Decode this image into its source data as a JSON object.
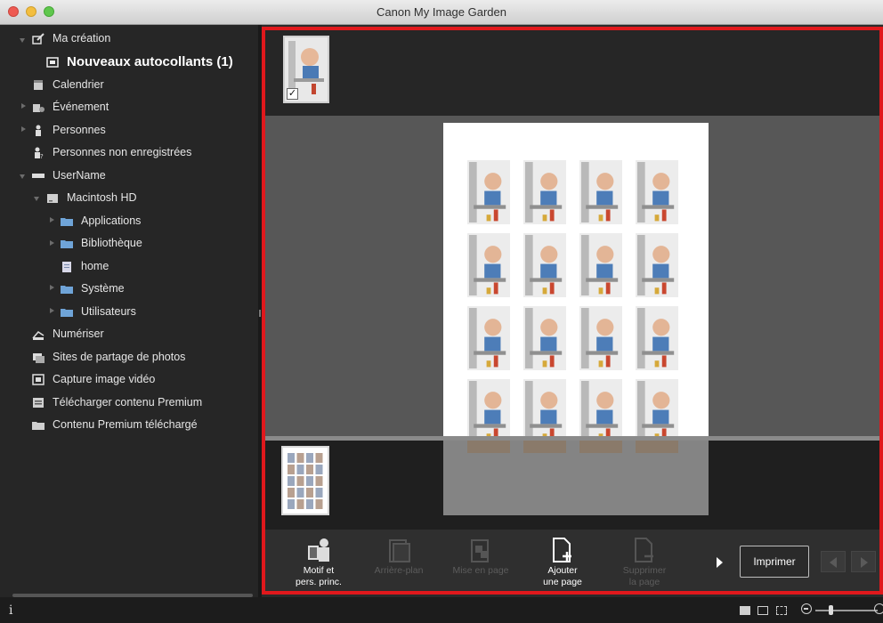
{
  "window": {
    "title": "Canon My Image Garden"
  },
  "sidebar": {
    "items": [
      {
        "label": "Ma création",
        "icon": "my-art-icon"
      },
      {
        "label": "Nouveaux autocollants (1)",
        "icon": "stickers-icon"
      },
      {
        "label": "Calendrier",
        "icon": "calendar-icon"
      },
      {
        "label": "Événement",
        "icon": "event-icon"
      },
      {
        "label": "Personnes",
        "icon": "people-icon"
      },
      {
        "label": "Personnes non enregistrées",
        "icon": "unregistered-people-icon"
      },
      {
        "label": "UserName",
        "icon": "drive-icon"
      },
      {
        "label": "Macintosh HD",
        "icon": "hard-disk-icon"
      },
      {
        "label": "Applications",
        "icon": "folder-icon"
      },
      {
        "label": "Bibliothèque",
        "icon": "folder-icon"
      },
      {
        "label": "home",
        "icon": "home-icon"
      },
      {
        "label": "Système",
        "icon": "folder-icon"
      },
      {
        "label": "Utilisateurs",
        "icon": "folder-icon"
      },
      {
        "label": "Numériser",
        "icon": "scan-icon"
      },
      {
        "label": "Sites de partage de photos",
        "icon": "photo-sharing-icon"
      },
      {
        "label": "Capture image vidéo",
        "icon": "video-capture-icon"
      },
      {
        "label": "Télécharger contenu Premium",
        "icon": "download-premium-icon"
      },
      {
        "label": "Contenu Premium téléchargé",
        "icon": "premium-folder-icon"
      }
    ]
  },
  "toolbar": {
    "design_label_1": "Motif et",
    "design_label_2": "pers. princ.",
    "background_label": "Arrière-plan",
    "layout_label": "Mise en page",
    "add_page_label_1": "Ajouter",
    "add_page_label_2": "une page",
    "delete_page_label_1": "Supprimer",
    "delete_page_label_2": "la page",
    "print_label": "Imprimer"
  },
  "status": {
    "info_icon": "i"
  },
  "colors": {
    "accent_border": "#e0181c",
    "panel_bg": "#262626"
  }
}
